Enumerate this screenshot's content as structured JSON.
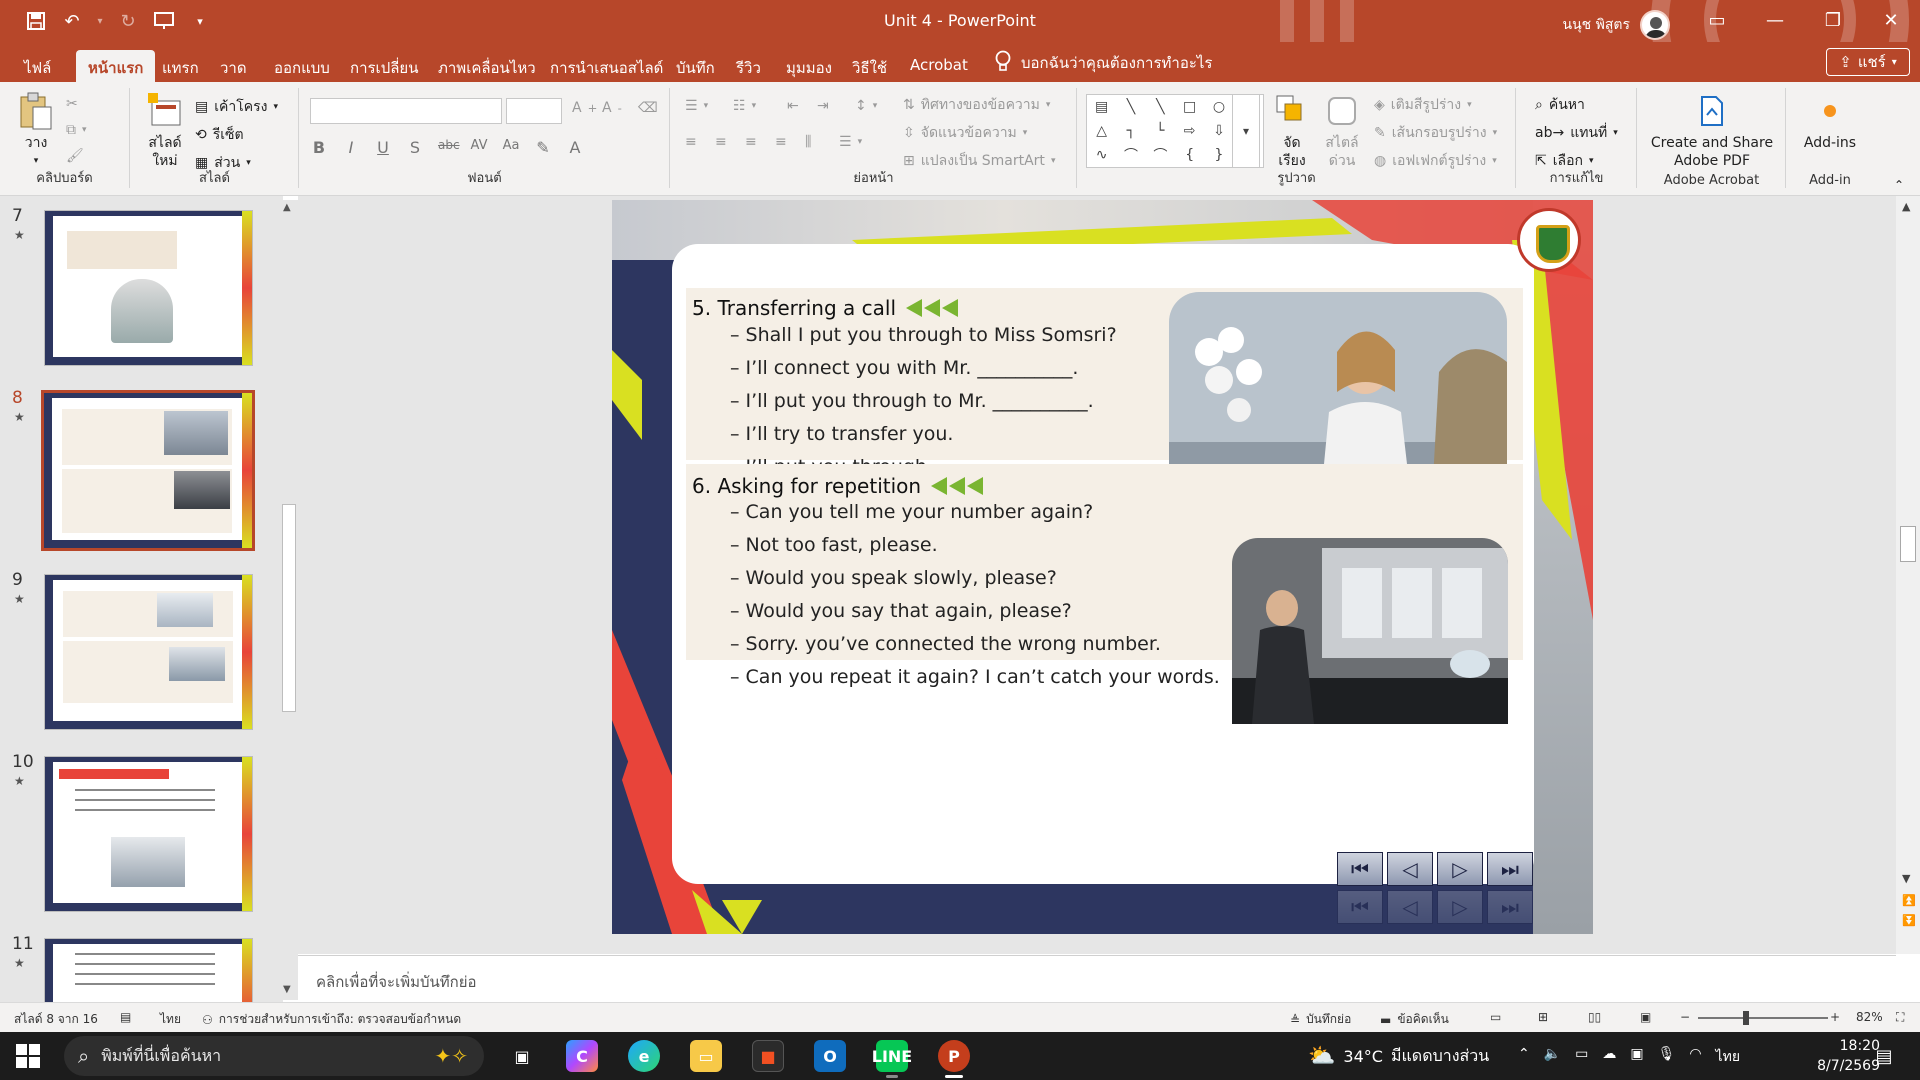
{
  "window": {
    "title": "Unit 4  -  PowerPoint",
    "user_name": "นนุช พิสูตร",
    "share_label": "แชร์"
  },
  "tabs": [
    {
      "label": "ไฟล์"
    },
    {
      "label": "หน้าแรก",
      "active": true
    },
    {
      "label": "แทรก"
    },
    {
      "label": "วาด"
    },
    {
      "label": "ออกแบบ"
    },
    {
      "label": "การเปลี่ยน"
    },
    {
      "label": "ภาพเคลื่อนไหว"
    },
    {
      "label": "การนำเสนอสไลด์"
    },
    {
      "label": "บันทึก"
    },
    {
      "label": "รีวิว"
    },
    {
      "label": "มุมมอง"
    },
    {
      "label": "วิธีใช้"
    },
    {
      "label": "Acrobat"
    }
  ],
  "tell_me": "บอกฉันว่าคุณต้องการทำอะไร",
  "ribbon": {
    "clipboard": {
      "paste": "วาง",
      "label": "คลิปบอร์ด"
    },
    "slides": {
      "new_slide": "สไลด์ใหม่",
      "layout": "เค้าโครง",
      "reset": "รีเซ็ต",
      "section": "ส่วน",
      "label": "สไลด์"
    },
    "font": {
      "label": "ฟอนต์"
    },
    "paragraph": {
      "text_direction": "ทิศทางของข้อความ",
      "align_text": "จัดแนวข้อความ",
      "smartart": "แปลงเป็น SmartArt",
      "label": "ย่อหน้า"
    },
    "drawing": {
      "arrange": "จัดเรียง",
      "quick_styles": "สไตล์ด่วน",
      "shape_fill": "เติมสีรูปร่าง",
      "shape_outline": "เส้นกรอบรูปร่าง",
      "shape_effects": "เอฟเฟกต์รูปร่าง",
      "label": "รูปวาด"
    },
    "editing": {
      "find": "ค้นหา",
      "replace": "แทนที่",
      "select": "เลือก",
      "label": "การแก้ไข"
    },
    "acrobat": {
      "create": "Create and Share Adobe PDF",
      "label": "Adobe Acrobat"
    },
    "addins": {
      "button": "Add-ins",
      "label": "Add-in"
    }
  },
  "thumbnails": [
    {
      "number": "7",
      "star": "★"
    },
    {
      "number": "8",
      "star": "★",
      "selected": true
    },
    {
      "number": "9",
      "star": "★"
    },
    {
      "number": "10",
      "star": "★"
    },
    {
      "number": "11",
      "star": "★"
    }
  ],
  "slide": {
    "section5": {
      "title": "5. Transferring a call",
      "items": [
        "– Shall I put you through to Miss Somsri?",
        "– I’ll connect you with Mr. __________.",
        "– I’ll put you through to Mr. __________.",
        "– I’ll try to transfer you.",
        "– I’ll put you through."
      ]
    },
    "section6": {
      "title": "6. Asking for repetition",
      "items": [
        "– Can you tell me your number again?",
        "– Not too fast, please.",
        "– Would you speak slowly, please?",
        "– Would you say that again, please?",
        "– Sorry. you’ve connected the wrong number.",
        "– Can you repeat it again? I can’t catch your words."
      ]
    }
  },
  "notes_placeholder": "คลิกเพื่อที่จะเพิ่มบันทึกย่อ",
  "status": {
    "slide_count": "สไลด์ 8 จาก 16",
    "language": "ไทย",
    "accessibility": "การช่วยสำหรับการเข้าถึง: ตรวจสอบข้อกำหนด",
    "notes": "บันทึกย่อ",
    "comments": "ข้อคิดเห็น",
    "zoom": "82%",
    "zoom_value": 0.82
  },
  "taskbar": {
    "search_placeholder": "พิมพ์ที่นี่เพื่อค้นหา",
    "temperature": "34°C",
    "weather": "มีแดดบางส่วน",
    "input_lang": "ไทย",
    "time": "18:20",
    "date": "8/7/2569"
  },
  "colors": {
    "accent": "#b7472a",
    "slide_navy": "#2d3660",
    "arrow_green": "#7ab531",
    "section_bg": "#f5efe6"
  }
}
